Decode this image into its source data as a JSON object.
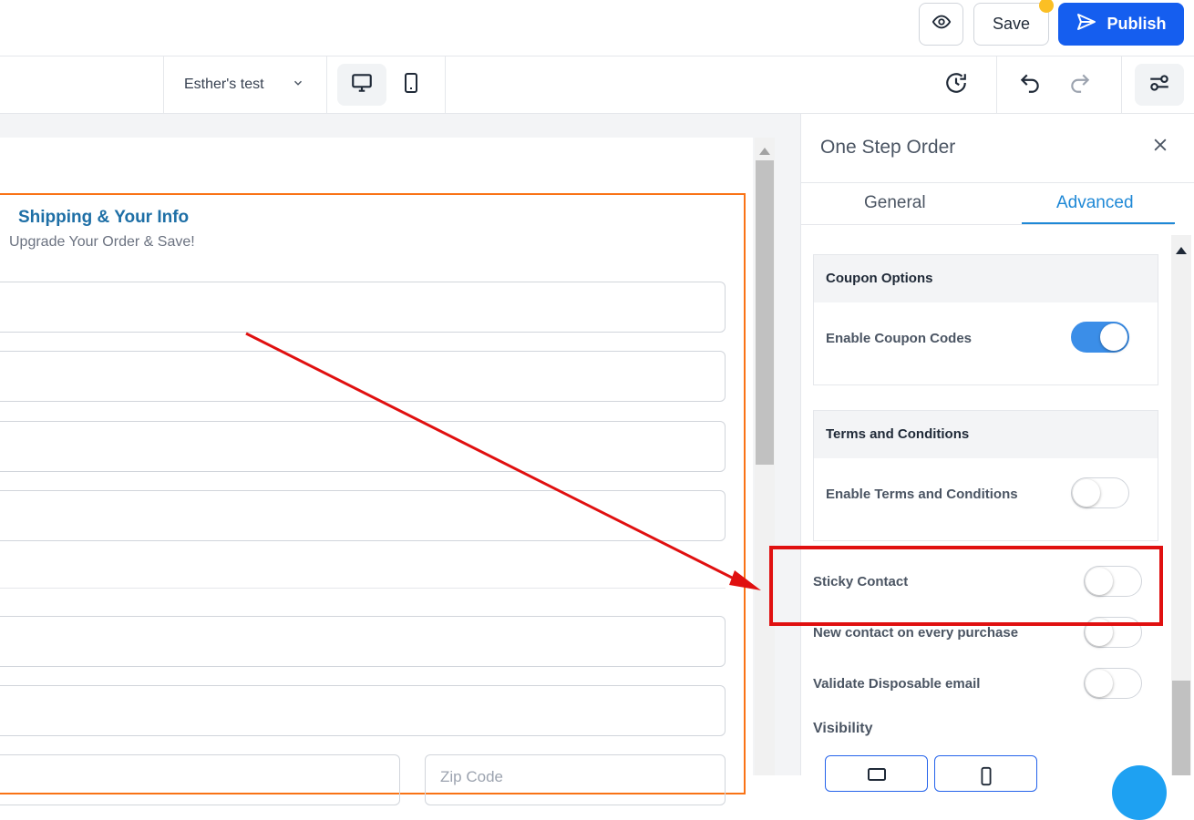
{
  "topbar": {
    "save_label": "Save",
    "publish_label": "Publish"
  },
  "toolbar": {
    "page_select_value": "Esther's test"
  },
  "canvas": {
    "form_title": "Shipping & Your Info",
    "form_subtitle": "Upgrade Your Order & Save!",
    "zip_placeholder": "Zip Code"
  },
  "panel": {
    "title": "One Step Order",
    "tabs": [
      {
        "label": "General",
        "active": false
      },
      {
        "label": "Advanced",
        "active": true
      }
    ],
    "coupon": {
      "header": "Coupon Options",
      "row_label": "Enable Coupon Codes",
      "enabled": true
    },
    "terms": {
      "header": "Terms and Conditions",
      "row_label": "Enable Terms and Conditions",
      "enabled": false
    },
    "options": [
      {
        "label": "Sticky Contact",
        "enabled": false
      },
      {
        "label": "New contact on every purchase",
        "enabled": false
      },
      {
        "label": "Validate Disposable email",
        "enabled": false
      }
    ],
    "visibility_label": "Visibility"
  },
  "colors": {
    "accent": "#155eef",
    "tab_active": "#1e88d6",
    "form_border": "#f97316",
    "annotation": "#e01010",
    "toggle_on": "#3b8ee8"
  }
}
